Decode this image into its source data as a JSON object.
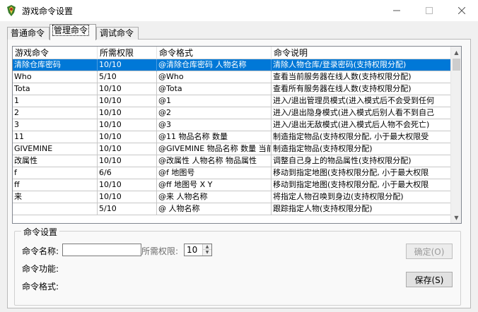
{
  "window": {
    "title": "游戏命令设置",
    "accent_color": "#0078d7"
  },
  "tabs": [
    {
      "label": "普通命令"
    },
    {
      "label": "管理命令"
    },
    {
      "label": "调试命令"
    }
  ],
  "table": {
    "columns": [
      "游戏命令",
      "所需权限",
      "命令格式",
      "命令说明"
    ],
    "rows": [
      [
        "清除仓库密码",
        "10/10",
        "@清除仓库密码 人物名称",
        "清除人物仓库/登录密码(支持权限分配)"
      ],
      [
        "Who",
        "5/10",
        "@Who",
        "查看当前服务器在线人数(支持权限分配)"
      ],
      [
        "Tota",
        "10/10",
        "@Tota",
        "查看所有服务器在线人数(支持权限分配)"
      ],
      [
        "1",
        "10/10",
        "@1",
        "进入/退出管理员模式(进入模式后不会受到任何"
      ],
      [
        "2",
        "10/10",
        "@2",
        "进入/退出隐身模式(进入模式后别人看不到自己"
      ],
      [
        "3",
        "10/10",
        "@3",
        "进入/退出无敌模式(进入模式后人物不会死亡)"
      ],
      [
        "11",
        "10/10",
        "@11 物品名称 数量",
        "制造指定物品(支持权限分配, 小于最大权限受"
      ],
      [
        "GIVEMINE",
        "10/10",
        "@GIVEMINE 物品名称 数量 当前",
        "制造指定物品(支持权限分配)"
      ],
      [
        "改属性",
        "10/10",
        "@改属性 人物名称 物品属性",
        "调整自己身上的物品属性(支持权限分配)"
      ],
      [
        "f",
        "6/6",
        "@f 地图号",
        "移动到指定地图(支持权限分配, 小于最大权限"
      ],
      [
        "ff",
        "10/10",
        "@ff 地图号 X Y",
        "移动到指定地图(支持权限分配, 小于最大权限"
      ],
      [
        "来",
        "10/10",
        "@来 人物名称",
        "将指定人物召唤到身边(支持权限分配)"
      ],
      [
        "",
        "5/10",
        "@ 人物名称",
        "跟踪指定人物(支持权限分配)"
      ]
    ]
  },
  "settings": {
    "group_title": "命令设置",
    "name_label": "命令名称:",
    "name_value": "",
    "permission_label": "所需权限:",
    "permission_value": "10",
    "function_label": "命令功能:",
    "format_label": "命令格式:",
    "confirm_label": "确定(O)",
    "save_label": "保存(S)"
  }
}
